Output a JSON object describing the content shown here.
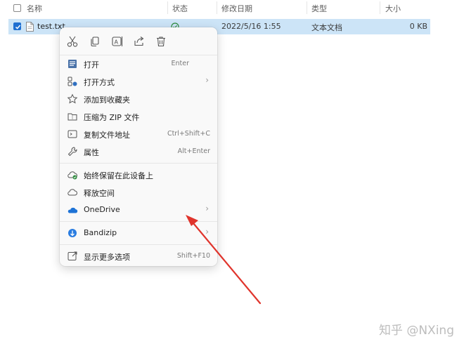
{
  "header": {
    "col_name": "名称",
    "col_status": "状态",
    "col_modified": "修改日期",
    "col_type": "类型",
    "col_size": "大小"
  },
  "file": {
    "name": "test.txt",
    "modified": "2022/5/16 1:55",
    "type": "文本文档",
    "size": "0 KB",
    "status_icon": "sync-check-icon"
  },
  "quick_actions": [
    {
      "icon": "cut-icon"
    },
    {
      "icon": "copy-icon"
    },
    {
      "icon": "rename-icon"
    },
    {
      "icon": "share-icon"
    },
    {
      "icon": "delete-icon"
    }
  ],
  "menu": {
    "open": {
      "label": "打开",
      "shortcut": "Enter"
    },
    "open_with": {
      "label": "打开方式"
    },
    "favorites": {
      "label": "添加到收藏夹"
    },
    "zip": {
      "label": "压缩为 ZIP 文件"
    },
    "copy_path": {
      "label": "复制文件地址",
      "shortcut": "Ctrl+Shift+C"
    },
    "properties": {
      "label": "属性",
      "shortcut": "Alt+Enter"
    },
    "always_keep": {
      "label": "始终保留在此设备上"
    },
    "free_space": {
      "label": "释放空间"
    },
    "onedrive": {
      "label": "OneDrive"
    },
    "bandizip": {
      "label": "Bandizip"
    },
    "more_options": {
      "label": "显示更多选项",
      "shortcut": "Shift+F10"
    }
  },
  "watermark": "知乎 @NXing",
  "colors": {
    "selection": "#cce4f7",
    "accent": "#1f6fd1",
    "annotation_arrow": "#e0342c"
  }
}
